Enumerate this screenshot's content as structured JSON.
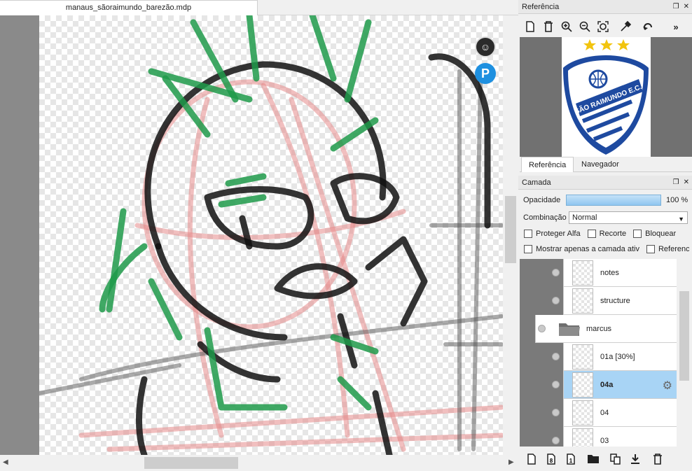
{
  "document": {
    "tab_title": "manaus_sãoraimundo_barezão.mdp"
  },
  "reference_panel": {
    "title": "Referência",
    "tabs": [
      {
        "label": "Referência",
        "active": true
      },
      {
        "label": "Navegador",
        "active": false
      }
    ],
    "logo_text": "SÃO RAIMUNDO E.C.",
    "logo_colors": {
      "blue": "#1e4aa0",
      "star": "#f2c40f"
    }
  },
  "layer_panel": {
    "title": "Camada",
    "opacity_label": "Opacidade",
    "opacity_value": "100 %",
    "opacity_fraction": 1.0,
    "blend_label": "Combinação",
    "blend_value": "Normal",
    "checkboxes": {
      "protect_alpha": "Proteger Alfa",
      "clipping": "Recorte",
      "lock": "Bloquear",
      "show_only": "Mostrar apenas a camada ativ",
      "reference": "Referenc"
    },
    "layers": [
      {
        "name": "notes",
        "type": "layer",
        "selected": false
      },
      {
        "name": "structure",
        "type": "layer",
        "selected": false
      },
      {
        "name": "marcus",
        "type": "folder",
        "selected": false
      },
      {
        "name": "01a [30%]",
        "type": "layer",
        "selected": false
      },
      {
        "name": "04a",
        "type": "layer",
        "selected": true
      },
      {
        "name": "04",
        "type": "layer",
        "selected": false
      },
      {
        "name": "03",
        "type": "layer",
        "selected": false
      }
    ]
  },
  "colors": {
    "selection": "#a8d4f5",
    "accent_blue": "#1e90e0"
  },
  "icons": {
    "reference_toolbar": [
      "new-file-icon",
      "delete-icon",
      "zoom-in-icon",
      "zoom-out-icon",
      "zoom-fit-icon",
      "eyedropper-icon",
      "rotate-icon",
      "more-icon"
    ],
    "layer_toolbar": [
      "new-layer-icon",
      "new-8bit-layer-icon",
      "new-1bit-layer-icon",
      "new-folder-icon",
      "duplicate-layer-icon",
      "merge-down-icon",
      "delete-layer-icon"
    ]
  }
}
